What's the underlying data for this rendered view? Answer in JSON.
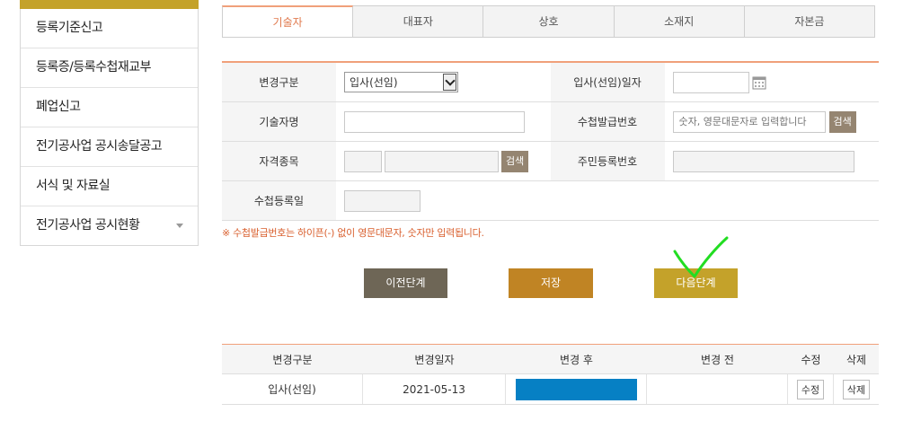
{
  "sidebar": {
    "items": [
      {
        "label": "등록기준신고"
      },
      {
        "label": "등록증/등록수첩재교부"
      },
      {
        "label": "폐업신고"
      },
      {
        "label": "전기공사업 공시송달공고"
      },
      {
        "label": "서식 및 자료실"
      },
      {
        "label": "전기공사업 공시현황"
      }
    ]
  },
  "tabs": [
    "기술자",
    "대표자",
    "상호",
    "소재지",
    "자본금"
  ],
  "form": {
    "change_type_label": "변경구분",
    "change_type_value": "입사(선임)",
    "join_date_label": "입사(선임)일자",
    "tech_name_label": "기술자명",
    "booklet_no_label": "수첩발급번호",
    "booklet_no_placeholder": "숫자, 영문대문자로 입력합니다",
    "search_label": "검색",
    "qualification_label": "자격종목",
    "rrn_label": "주민등록번호",
    "booklet_reg_date_label": "수첩등록일"
  },
  "notice": "※ 수첩발급번호는 하이픈(-) 없이 영문대문자, 숫자만 입력됩니다.",
  "buttons": {
    "prev": "이전단계",
    "save": "저장",
    "next": "다음단계"
  },
  "colors": {
    "accent": "#f0a07a",
    "gold": "#c4a22a",
    "prev_btn": "#6e6656",
    "save_btn": "#c08424",
    "next_btn": "#c4a22a",
    "search_btn": "#958571",
    "check_mark": "#22dd22"
  },
  "table": {
    "headers": [
      "변경구분",
      "변경일자",
      "변경 후",
      "변경 전",
      "수정",
      "삭제"
    ],
    "rows": [
      {
        "change_type": "입사(선임)",
        "date": "2021-05-13",
        "after": "",
        "before": "",
        "edit": "수정",
        "delete": "삭제"
      }
    ]
  }
}
